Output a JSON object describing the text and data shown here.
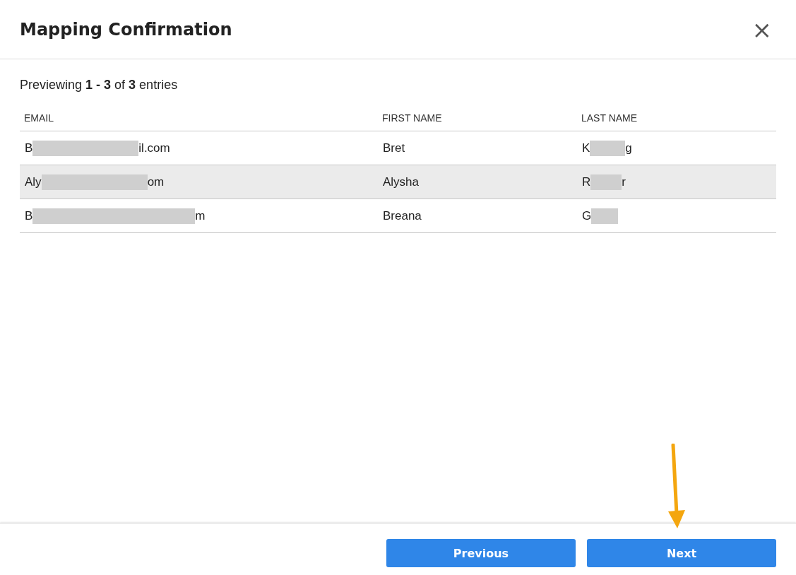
{
  "dialog": {
    "title": "Mapping Confirmation",
    "close": "×"
  },
  "summary": "Previewing **1 - 3** of **3** entries",
  "table": {
    "columns": [
      "EMAIL",
      "FIRST NAME",
      "LAST NAME"
    ],
    "rows": [
      {
        "selected": false,
        "cells": [
          {
            "before": "B",
            "after": "il.com",
            "redacted": true
          },
          {
            "before": "Bret",
            "redacted": false
          },
          {
            "before": "K",
            "after": "g",
            "redacted": true
          }
        ]
      },
      {
        "selected": true,
        "cells": [
          {
            "before": "Aly",
            "after": "om",
            "redacted": true
          },
          {
            "before": "Alysha",
            "redacted": false
          },
          {
            "before": "R",
            "after": "r",
            "redacted": true
          }
        ]
      },
      {
        "selected": false,
        "cells": [
          {
            "before": "B",
            "after": "m",
            "redacted": true
          },
          {
            "before": "Breana",
            "redacted": false
          },
          {
            "before": "G",
            "redacted": true
          }
        ]
      }
    ]
  },
  "buttons": [
    "Previous",
    "Next"
  ]
}
